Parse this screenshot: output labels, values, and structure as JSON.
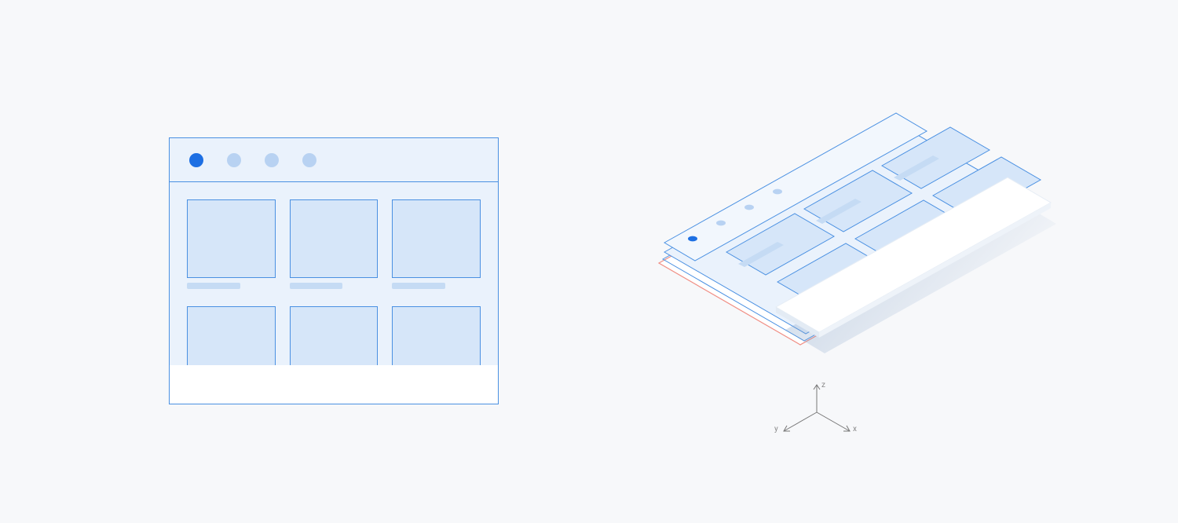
{
  "colors": {
    "accent": "#1d6fe3",
    "accent_light": "#b8d2f2",
    "panel_fill": "#eaf2fc",
    "card_fill": "#d6e6f9",
    "stroke": "#4a90e2",
    "red_stroke": "#f08e84",
    "overlay_white": "#ffffff",
    "shadow": "#9db7d6"
  },
  "flat": {
    "tabs": [
      {
        "active": true
      },
      {
        "active": false
      },
      {
        "active": false
      },
      {
        "active": false
      }
    ],
    "grid_rows": 2,
    "grid_cols": 3
  },
  "iso": {
    "tabs": [
      {
        "active": true
      },
      {
        "active": false
      },
      {
        "active": false
      },
      {
        "active": false
      }
    ],
    "grid_rows": 2,
    "grid_cols": 3,
    "axes": {
      "x": "x",
      "y": "y",
      "z": "z"
    }
  }
}
